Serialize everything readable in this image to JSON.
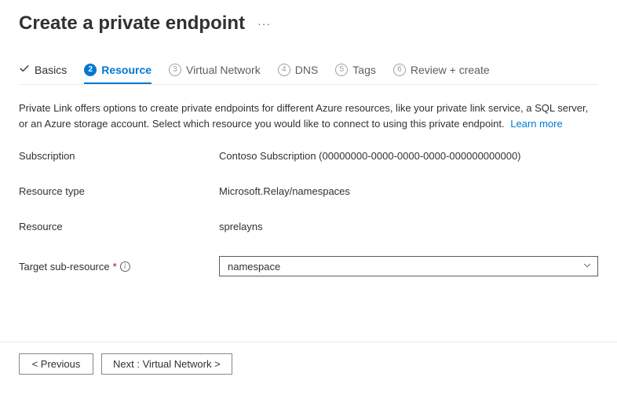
{
  "header": {
    "title": "Create a private endpoint"
  },
  "tabs": {
    "basics": "Basics",
    "resource": "Resource",
    "virtual_network_num": "3",
    "virtual_network": "Virtual Network",
    "dns_num": "4",
    "dns": "DNS",
    "tags_num": "5",
    "tags": "Tags",
    "review_num": "6",
    "review": "Review + create"
  },
  "description": {
    "text": "Private Link offers options to create private endpoints for different Azure resources, like your private link service, a SQL server, or an Azure storage account. Select which resource you would like to connect to using this private endpoint.",
    "learn_more": "Learn more"
  },
  "form": {
    "subscription_label": "Subscription",
    "subscription_value": "Contoso Subscription (00000000-0000-0000-0000-000000000000)",
    "resource_type_label": "Resource type",
    "resource_type_value": "Microsoft.Relay/namespaces",
    "resource_label": "Resource",
    "resource_value": "sprelayns",
    "target_sub_label": "Target sub-resource",
    "target_sub_value": "namespace"
  },
  "footer": {
    "previous": "< Previous",
    "next": "Next : Virtual Network >"
  }
}
